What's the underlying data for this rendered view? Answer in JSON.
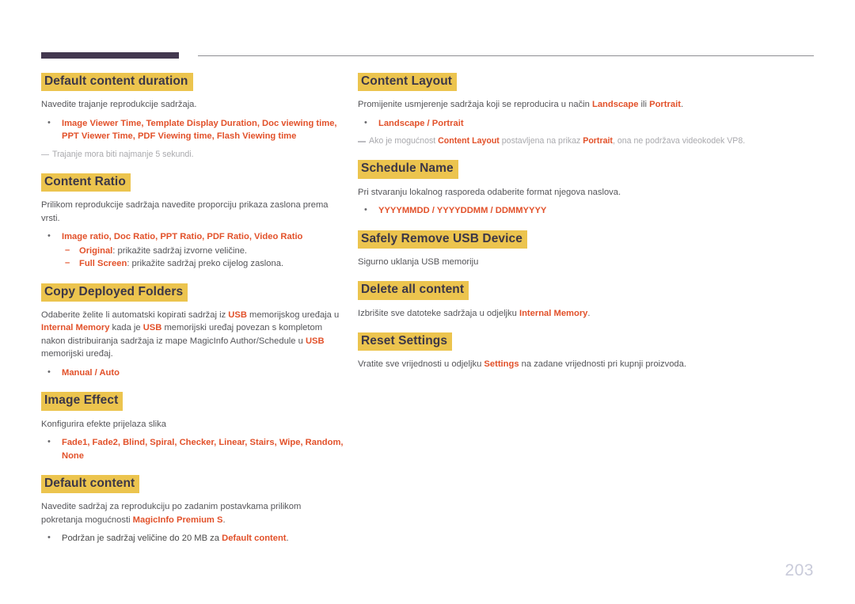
{
  "colors": {
    "heading_highlight": "#ecc44e",
    "heading_text": "#3c3747",
    "accent_term": "#e2512a",
    "body_text": "#555559",
    "note_text": "#a9a9ad",
    "rule_thick": "#43384f",
    "rule_thin": "#8e8e93",
    "page_number": "#c9cbda"
  },
  "page_number": "203",
  "left_column": {
    "sections": [
      {
        "heading": "Default content duration",
        "body": "Navedite trajanje reprodukcije sadržaja.",
        "bullet_terms": "Image Viewer Time, Template Display Duration, Doc viewing time, PPT Viewer Time, PDF Viewing time, Flash Viewing time",
        "note": "Trajanje mora biti najmanje 5 sekundi."
      },
      {
        "heading": "Content Ratio",
        "body": "Prilikom reprodukcije sadržaja navedite proporciju prikaza zaslona prema vrsti.",
        "bullet_terms": "Image ratio, Doc Ratio, PPT Ratio, PDF Ratio, Video Ratio",
        "sub_bullets": [
          {
            "term": "Original",
            "text": ": prikažite sadržaj izvorne veličine."
          },
          {
            "term": "Full Screen",
            "text": ": prikažite sadržaj preko cijelog zaslona."
          }
        ]
      },
      {
        "heading": "Copy Deployed Folders",
        "body_parts": [
          {
            "text": "Odaberite želite li automatski kopirati sadržaj iz ",
            "accent": false
          },
          {
            "text": "USB",
            "accent": true
          },
          {
            "text": " memorijskog uređaja u ",
            "accent": false
          },
          {
            "text": "Internal Memory",
            "accent": true
          },
          {
            "text": " kada je ",
            "accent": false
          },
          {
            "text": "USB",
            "accent": true
          },
          {
            "text": " memorijski uređaj povezan s kompletom nakon distribuiranja sadržaja iz mape MagicInfo Author/Schedule u ",
            "accent": false
          },
          {
            "text": "USB",
            "accent": true
          },
          {
            "text": " memorijski uređaj.",
            "accent": false
          }
        ],
        "bullet_terms": "Manual / Auto"
      },
      {
        "heading": "Image Effect",
        "body": "Konfigurira efekte prijelaza slika",
        "bullet_terms": "Fade1, Fade2, Blind, Spiral, Checker, Linear, Stairs, Wipe, Random, None"
      },
      {
        "heading": "Default content",
        "body_parts": [
          {
            "text": "Navedite sadržaj za reprodukciju po zadanim postavkama prilikom pokretanja mogućnosti ",
            "accent": false
          },
          {
            "text": "MagicInfo Premium S",
            "accent": true
          },
          {
            "text": ".",
            "accent": false
          }
        ],
        "bullet_parts": [
          {
            "text": "Podržan je sadržaj veličine do 20 MB za ",
            "accent": false
          },
          {
            "text": "Default content",
            "accent": true
          },
          {
            "text": ".",
            "accent": false
          }
        ]
      }
    ]
  },
  "right_column": {
    "sections": [
      {
        "heading": "Content Layout",
        "body_parts": [
          {
            "text": "Promijenite usmjerenje sadržaja koji se reproducira u način ",
            "accent": false
          },
          {
            "text": "Landscape",
            "accent": true
          },
          {
            "text": " ili ",
            "accent": false
          },
          {
            "text": "Portrait",
            "accent": true
          },
          {
            "text": ".",
            "accent": false
          }
        ],
        "bullet_terms": "Landscape / Portrait",
        "note_parts": [
          {
            "text": "Ako je mogućnost ",
            "accent": false
          },
          {
            "text": "Content Layout",
            "accent": true
          },
          {
            "text": " postavljena na prikaz ",
            "accent": false
          },
          {
            "text": "Portrait",
            "accent": true
          },
          {
            "text": ", ona ne podržava videokodek VP8.",
            "accent": false
          }
        ]
      },
      {
        "heading": "Schedule Name",
        "body": "Pri stvaranju lokalnog rasporeda odaberite format njegova naslova.",
        "bullet_terms": "YYYYMMDD / YYYYDDMM / DDMMYYYY"
      },
      {
        "heading": "Safely Remove USB Device",
        "body": "Sigurno uklanja USB memoriju"
      },
      {
        "heading": "Delete all content",
        "body_parts": [
          {
            "text": "Izbrišite sve datoteke sadržaja u odjeljku ",
            "accent": false
          },
          {
            "text": "Internal Memory",
            "accent": true
          },
          {
            "text": ".",
            "accent": false
          }
        ]
      },
      {
        "heading": "Reset Settings",
        "body_parts": [
          {
            "text": "Vratite sve vrijednosti u odjeljku ",
            "accent": false
          },
          {
            "text": "Settings",
            "accent": true
          },
          {
            "text": " na zadane vrijednosti pri kupnji proizvoda.",
            "accent": false
          }
        ]
      }
    ]
  }
}
